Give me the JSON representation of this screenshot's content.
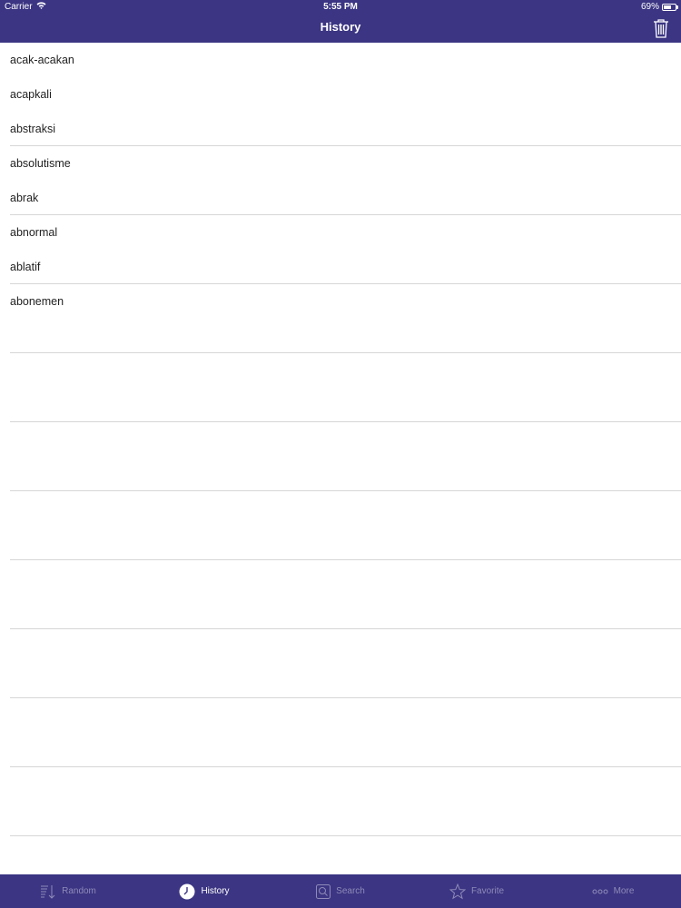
{
  "status_bar": {
    "carrier": "Carrier",
    "time": "5:55 PM",
    "battery_percent": "69%",
    "battery_level": 0.69
  },
  "nav": {
    "title": "History",
    "trash_icon": "trash-icon"
  },
  "history": {
    "items": [
      "acak-acakan",
      "acapkali",
      "abstraksi",
      "absolutisme",
      "abrak",
      "abnormal",
      "ablatif",
      "abonemen"
    ]
  },
  "tab_bar": {
    "active": "History",
    "tabs": [
      {
        "label": "Random",
        "icon": "sort-down-icon"
      },
      {
        "label": "History",
        "icon": "clock-icon"
      },
      {
        "label": "Search",
        "icon": "search-icon"
      },
      {
        "label": "Favorite",
        "icon": "star-icon"
      },
      {
        "label": "More",
        "icon": "more-dots-icon"
      }
    ]
  },
  "colors": {
    "bar": "#3b3583",
    "tab_active": "#ffffff",
    "tab_inactive": "#8f8ab8",
    "divider": "#d6d6d6"
  }
}
